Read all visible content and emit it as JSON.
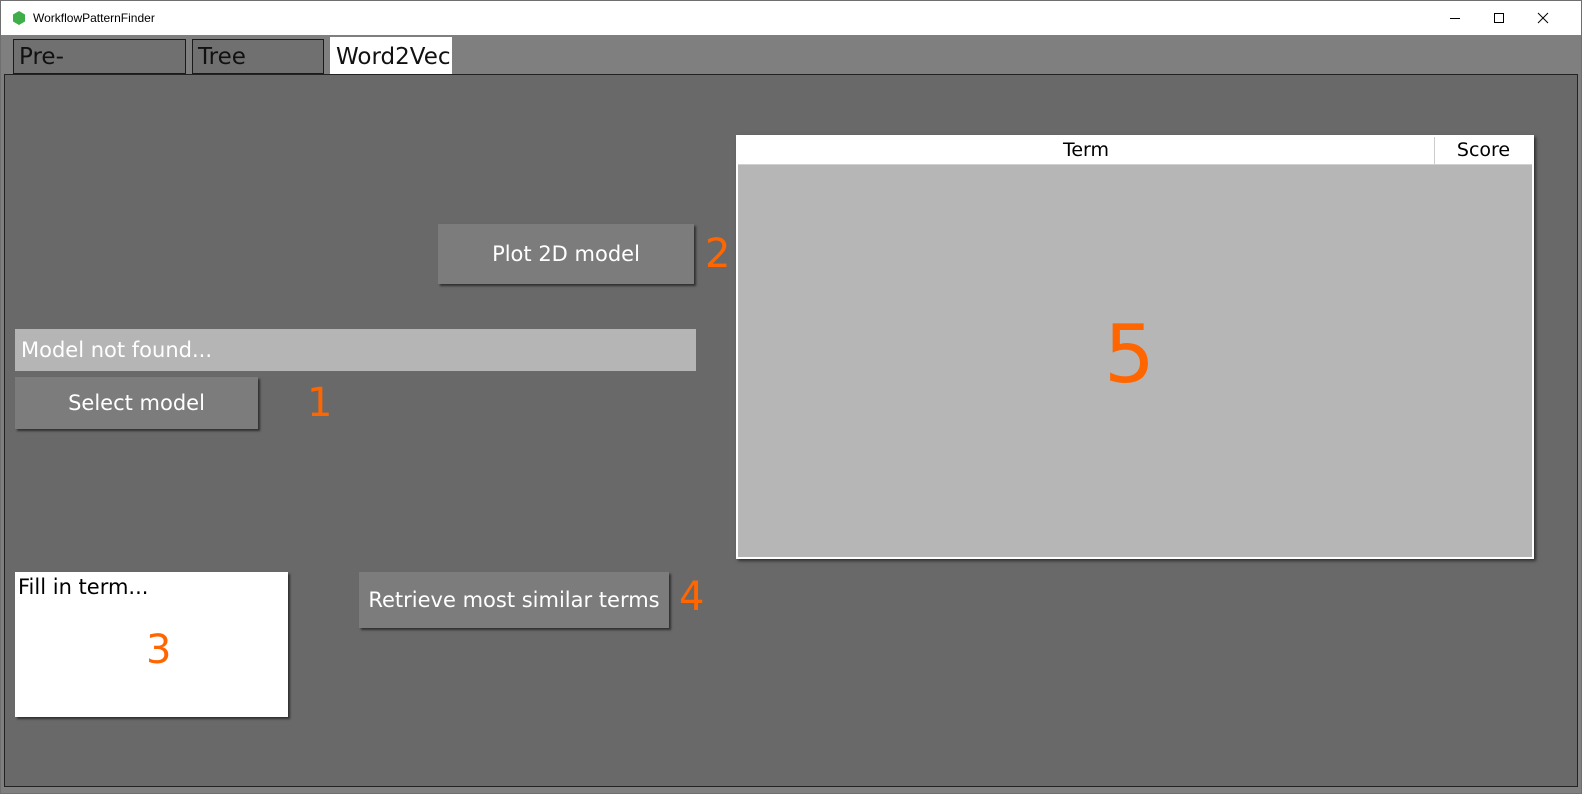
{
  "window": {
    "title": "WorkflowPatternFinder",
    "icon": "green-hexagon-icon",
    "controls": [
      "minimize-icon",
      "maximize-icon",
      "close-icon"
    ]
  },
  "tabs": [
    {
      "label": "Pre-processing",
      "active": false
    },
    {
      "label": "Tree Finder",
      "active": false
    },
    {
      "label": "Word2Vec",
      "active": true
    }
  ],
  "word2vec": {
    "plot_button": "Plot 2D model",
    "model_path": "Model not found...",
    "select_model_button": "Select model",
    "term_placeholder": "Fill in term...",
    "retrieve_button": "Retrieve most similar terms",
    "results_table": {
      "columns": [
        "Term",
        "Score"
      ],
      "rows": []
    }
  },
  "annotations": {
    "color": "#ff6600",
    "select_model": "1",
    "plot": "2",
    "term": "3",
    "retrieve": "4",
    "table": "5"
  },
  "colors": {
    "background": "#696969",
    "button": "#7c7c7c",
    "path_box": "#b5b5b5",
    "table_body": "#b6b6b6"
  }
}
